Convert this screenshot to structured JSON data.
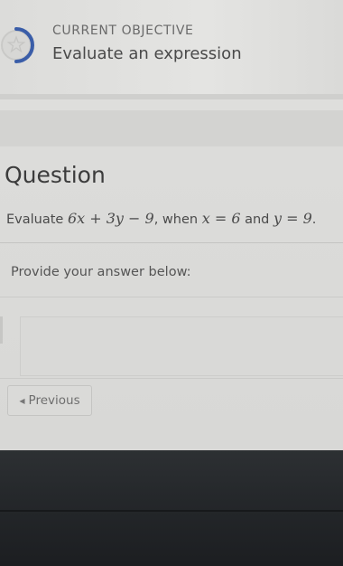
{
  "objective": {
    "label": "CURRENT OBJECTIVE",
    "title": "Evaluate an expression",
    "icon": "star-progress-icon"
  },
  "question": {
    "heading": "Question",
    "prefix": "Evaluate ",
    "expression": "6x + 3y − 9",
    "middle": ", when ",
    "cond1": "x = 6",
    "and": " and ",
    "cond2": "y = 9",
    "suffix": ".",
    "prompt": "Provide your answer below:",
    "answer_value": ""
  },
  "nav": {
    "previous_label": "Previous"
  },
  "colors": {
    "accent": "#3a5da8",
    "background": "#dcdcda",
    "footer": "#25282b"
  }
}
